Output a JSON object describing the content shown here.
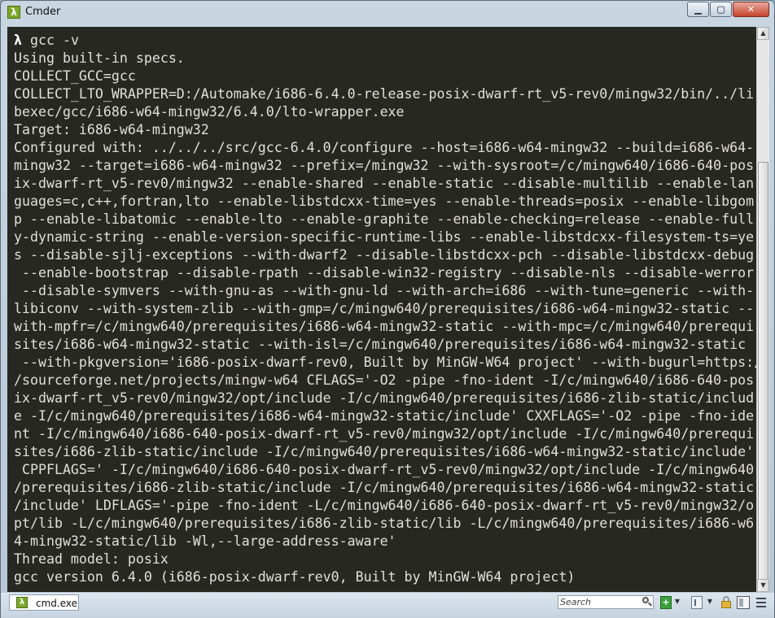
{
  "window": {
    "title": "Cmder",
    "app_icon_glyph": "λ",
    "controls": {
      "minimize": "▁",
      "maximize": "▢",
      "close": "✕"
    }
  },
  "terminal": {
    "prompt_symbol": "λ",
    "command": "gcc -v",
    "output_lines": [
      "Using built-in specs.",
      "COLLECT_GCC=gcc",
      "COLLECT_LTO_WRAPPER=D:/Automake/i686-6.4.0-release-posix-dwarf-rt_v5-rev0/mingw32/bin/../li",
      "bexec/gcc/i686-w64-mingw32/6.4.0/lto-wrapper.exe",
      "Target: i686-w64-mingw32",
      "Configured with: ../../../src/gcc-6.4.0/configure --host=i686-w64-mingw32 --build=i686-w64-",
      "mingw32 --target=i686-w64-mingw32 --prefix=/mingw32 --with-sysroot=/c/mingw640/i686-640-pos",
      "ix-dwarf-rt_v5-rev0/mingw32 --enable-shared --enable-static --disable-multilib --enable-lan",
      "guages=c,c++,fortran,lto --enable-libstdcxx-time=yes --enable-threads=posix --enable-libgom",
      "p --enable-libatomic --enable-lto --enable-graphite --enable-checking=release --enable-full",
      "y-dynamic-string --enable-version-specific-runtime-libs --enable-libstdcxx-filesystem-ts=ye",
      "s --disable-sjlj-exceptions --with-dwarf2 --disable-libstdcxx-pch --disable-libstdcxx-debug",
      " --enable-bootstrap --disable-rpath --disable-win32-registry --disable-nls --disable-werror",
      " --disable-symvers --with-gnu-as --with-gnu-ld --with-arch=i686 --with-tune=generic --with-",
      "libiconv --with-system-zlib --with-gmp=/c/mingw640/prerequisites/i686-w64-mingw32-static --",
      "with-mpfr=/c/mingw640/prerequisites/i686-w64-mingw32-static --with-mpc=/c/mingw640/prerequi",
      "sites/i686-w64-mingw32-static --with-isl=/c/mingw640/prerequisites/i686-w64-mingw32-static",
      " --with-pkgversion='i686-posix-dwarf-rev0, Built by MinGW-W64 project' --with-bugurl=https:/",
      "/sourceforge.net/projects/mingw-w64 CFLAGS='-O2 -pipe -fno-ident -I/c/mingw640/i686-640-pos",
      "ix-dwarf-rt_v5-rev0/mingw32/opt/include -I/c/mingw640/prerequisites/i686-zlib-static/includ",
      "e -I/c/mingw640/prerequisites/i686-w64-mingw32-static/include' CXXFLAGS='-O2 -pipe -fno-ide",
      "nt -I/c/mingw640/i686-640-posix-dwarf-rt_v5-rev0/mingw32/opt/include -I/c/mingw640/prerequi",
      "sites/i686-zlib-static/include -I/c/mingw640/prerequisites/i686-w64-mingw32-static/include'",
      " CPPFLAGS=' -I/c/mingw640/i686-640-posix-dwarf-rt_v5-rev0/mingw32/opt/include -I/c/mingw640",
      "/prerequisites/i686-zlib-static/include -I/c/mingw640/prerequisites/i686-w64-mingw32-static",
      "/include' LDFLAGS='-pipe -fno-ident -L/c/mingw640/i686-640-posix-dwarf-rt_v5-rev0/mingw32/o",
      "pt/lib -L/c/mingw640/prerequisites/i686-zlib-static/lib -L/c/mingw640/prerequisites/i686-w6",
      "4-mingw32-static/lib -Wl,--large-address-aware'",
      "Thread model: posix",
      "gcc version 6.4.0 (i686-posix-dwarf-rev0, Built by MinGW-W64 project)"
    ],
    "colors": {
      "background": "#272822",
      "text": "#e0e0d8"
    }
  },
  "scrollbar": {
    "up_arrow": "▲",
    "down_arrow": "▼"
  },
  "statusbar": {
    "tabs": [
      {
        "label": "cmd.exe",
        "icon_glyph": "λ"
      }
    ],
    "search": {
      "placeholder": "Search"
    },
    "add_glyph": "+",
    "dropdown_glyph": "▼"
  }
}
